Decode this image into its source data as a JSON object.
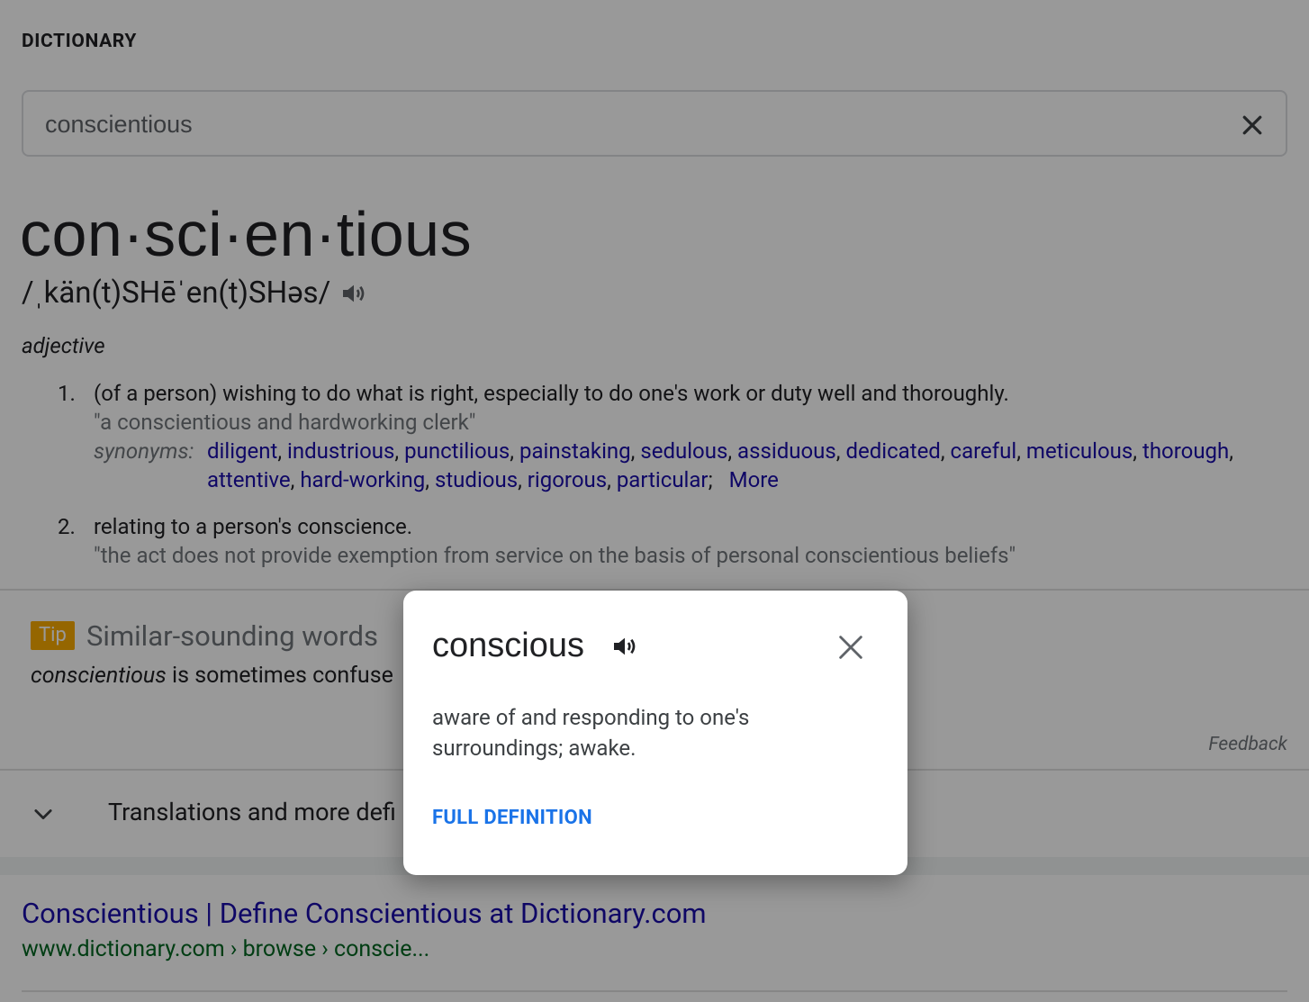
{
  "header": {
    "title": "DICTIONARY"
  },
  "search": {
    "value": "conscientious"
  },
  "entry": {
    "headword": "con·sci·en·tious",
    "pronunciation": "/ˌkän(t)SHēˈen(t)SHəs/",
    "part_of_speech": "adjective",
    "senses": [
      {
        "number": "1",
        "definition": "(of a person) wishing to do what is right, especially to do one's work or duty well and thoroughly.",
        "example": "\"a conscientious and hardworking clerk\"",
        "synonyms_label": "synonyms:",
        "synonyms": [
          "diligent",
          "industrious",
          "punctilious",
          "painstaking",
          "sedulous",
          "assiduous",
          "dedicated",
          "careful",
          "meticulous",
          "thorough",
          "attentive",
          "hard-working",
          "studious",
          "rigorous",
          "particular"
        ],
        "more_label": "More"
      },
      {
        "number": "2",
        "definition": "relating to a person's conscience.",
        "example": "\"the act does not provide exemption from service on the basis of personal conscientious beliefs\""
      }
    ]
  },
  "tip": {
    "badge": "Tip",
    "title": "Similar-sounding words",
    "word": "conscientious",
    "text": " is sometimes confuse"
  },
  "feedback_label": "Feedback",
  "translations": {
    "label": "Translations and more defi"
  },
  "result": {
    "title": "Conscientious | Define Conscientious at Dictionary.com",
    "url": "www.dictionary.com › browse › conscie..."
  },
  "dialog": {
    "word": "conscious",
    "definition": "aware of and responding to one's surroundings; awake.",
    "full_definition_label": "FULL DEFINITION"
  },
  "colors": {
    "link": "#1a0dab",
    "url_green": "#006621",
    "tip_badge": "#f9ab00",
    "full_definition": "#1a73e8",
    "overlay": "rgba(0,0,0,0.4)"
  }
}
